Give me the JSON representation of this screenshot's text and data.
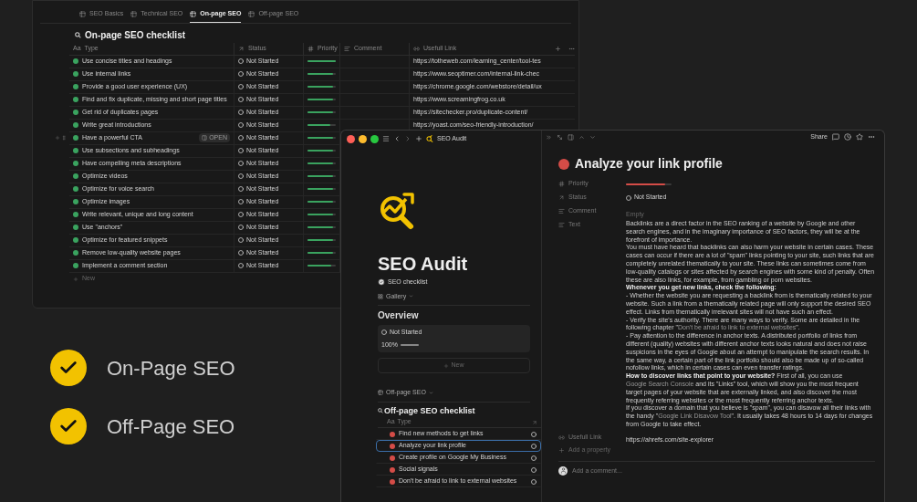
{
  "back_window": {
    "tabs": [
      {
        "label": "SEO Basics",
        "selected": false
      },
      {
        "label": "Technical SEO",
        "selected": false
      },
      {
        "label": "On-page SEO",
        "selected": true
      },
      {
        "label": "Off-page SEO",
        "selected": false
      }
    ],
    "title": "On-page SEO checklist",
    "type_glyph": "Aa",
    "columns": [
      "Type",
      "Status",
      "Priority",
      "Comment",
      "Usefull Link"
    ],
    "rows": [
      {
        "type": "Use concise titles and headings",
        "status": "Not Started",
        "level": 1,
        "link": "https://totheweb.com/learning_center/tool-tes"
      },
      {
        "type": "Use internal links",
        "status": "Not Started",
        "level": 0.9,
        "link": "https://www.seoptimer.com/internal-link-chec"
      },
      {
        "type": "Provide a good user experience (UX)",
        "status": "Not Started",
        "level": 0.9,
        "link": "https://chrome.google.com/webstore/detail/ux"
      },
      {
        "type": "Find and fix duplicate, missing and short page titles",
        "status": "Not Started",
        "level": 0.9,
        "link": "https://www.screamingfrog.co.uk"
      },
      {
        "type": "Get rid of duplicates pages",
        "status": "Not Started",
        "level": 0.9,
        "link": "https://sitechecker.pro/duplicate-content/"
      },
      {
        "type": "Write great introductions",
        "status": "Not Started",
        "level": 0.8,
        "link": "https://yoast.com/seo-friendly-introduction/"
      },
      {
        "type": "Have a powerful CTA",
        "status": "Not Started",
        "level": 0.9,
        "open_label": "OPEN"
      },
      {
        "type": "Use subsections and subheadings",
        "status": "Not Started",
        "level": 0.9
      },
      {
        "type": "Have compelling meta descriptions",
        "status": "Not Started",
        "level": 0.9
      },
      {
        "type": "Optimize videos",
        "status": "Not Started",
        "level": 0.9
      },
      {
        "type": "Optimize for voice search",
        "status": "Not Started",
        "level": 0.9
      },
      {
        "type": "Optimize images",
        "status": "Not Started",
        "level": 0.9
      },
      {
        "type": "Write relevant, unique and long content",
        "status": "Not Started",
        "level": 0.9
      },
      {
        "type": "Use \"anchors\"",
        "status": "Not Started",
        "level": 0.9
      },
      {
        "type": "Optimize for featured snippets",
        "status": "Not Started",
        "level": 0.9
      },
      {
        "type": "Remove low-quality website pages",
        "status": "Not Started",
        "level": 0.9
      },
      {
        "type": "Implement a comment section",
        "status": "Not Started",
        "level": 0.85
      }
    ],
    "new_label": "New"
  },
  "features": [
    {
      "label": "On-Page SEO",
      "checked": true
    },
    {
      "label": "Off-Page SEO",
      "checked": true
    }
  ],
  "front_window": {
    "breadcrumb": "SEO Audit",
    "page_title": "SEO Audit",
    "linked": "SEO checklist",
    "view": "Gallery",
    "overview_title": "Overview",
    "card": {
      "status": "Not Started",
      "percent": "100%",
      "level": 1
    },
    "new_label": "New",
    "off_view": "Off-page SEO",
    "off_title": "Off-page SEO checklist",
    "type_glyph": "Aa",
    "off_column": "Type",
    "off_rows": [
      {
        "type": "Find new methods to get links",
        "selected": false
      },
      {
        "type": "Analyze your link profile",
        "selected": true
      },
      {
        "type": "Create profile on Google My Business",
        "selected": false
      },
      {
        "type": "Social signals",
        "selected": false
      },
      {
        "type": "Don't be afraid to link to external websites",
        "selected": false
      }
    ]
  },
  "peek": {
    "share": "Share",
    "title": "Analyze your link profile",
    "properties": [
      {
        "kind": "bar",
        "name": "Priority",
        "level": 0.85
      },
      {
        "kind": "status",
        "name": "Status",
        "value": "Not Started"
      },
      {
        "kind": "empty",
        "name": "Comment",
        "value": "Empty"
      },
      {
        "kind": "text",
        "name": "Text",
        "paragraphs": [
          [
            {
              "kind": "plain",
              "text": "Backlinks are a direct factor in the SEO ranking of a website by Google and other search engines, and in the imaginary importance of SEO factors, they will be at the forefront of importance."
            }
          ],
          [
            {
              "kind": "plain",
              "text": "You must have heard that backlinks can also harm your website in certain cases. These cases can occur if there are a lot of \"spam\" links pointing to your site, such links that are completely unrelated thematically to your site. These links can sometimes come from low-quality catalogs or sites affected by search engines with some kind of penalty. Often these are also links, for example, from gambling or porn websites."
            }
          ],
          [
            {
              "kind": "bold",
              "text": "Whenever you get new links, check the following:"
            }
          ],
          [
            {
              "kind": "plain",
              "text": "- Whether the website you are requesting a backlink from is thematically related to your website. Such a link from a thematically related page will only support the desired SEO effect. Links from thematically irrelevant sites will not have such an effect."
            }
          ],
          [
            {
              "kind": "plain",
              "text": "- Verify the site's authority. There are many ways to verify. Some are detailed in the following chapter \""
            },
            {
              "kind": "link",
              "text": "Don't be afraid to link to external websites"
            },
            {
              "kind": "plain",
              "text": "\"."
            }
          ],
          [
            {
              "kind": "plain",
              "text": "- Pay attention to the difference in anchor texts. A distributed portfolio of links from different (quality) websites with different anchor texts looks natural and does not raise suspicions in the eyes of Google about an attempt to manipulate the search results. In the same way, a certain part of the link portfolio should also be made up of so-called nofollow links, which in certain cases can even transfer ratings."
            }
          ],
          [
            {
              "kind": "bold",
              "text": "How to discover links that point to your website?"
            },
            {
              "kind": "plain",
              "text": " First of all, you can use "
            },
            {
              "kind": "link",
              "text": "Google Search Console"
            },
            {
              "kind": "plain",
              "text": " and its \"Links\" tool, which will show you the most frequent target pages of your website that are externally linked, and also discover the most frequently referring websites or the most frequently referring anchor texts."
            }
          ],
          [
            {
              "kind": "plain",
              "text": "If you discover a domain that you believe is \"spam\", you can disavow all their links with the handy \""
            },
            {
              "kind": "link",
              "text": "Google Link Disavow Tool"
            },
            {
              "kind": "plain",
              "text": "\". It usually takes 48 hours to 14 days for changes from Google to take effect."
            }
          ]
        ]
      },
      {
        "kind": "link",
        "name": "Usefull Link",
        "value": "https://ahrefs.com/site-explorer"
      }
    ],
    "add_property": "Add a property",
    "comment_placeholder": "Add a comment..."
  }
}
